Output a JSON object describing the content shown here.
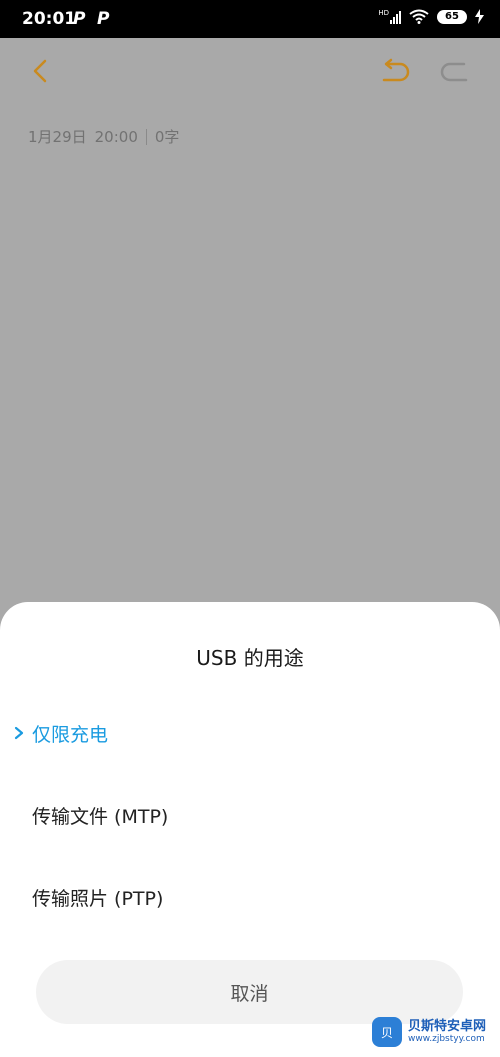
{
  "status_bar": {
    "time": "20:01",
    "notif_glyph_1": "P",
    "notif_glyph_2": "P",
    "hd_label": "HD",
    "battery_level": "65",
    "icons": [
      "signal-icon",
      "wifi-icon",
      "battery-icon",
      "charging-icon"
    ]
  },
  "toolbar": {
    "back_icon": "chevron-left-icon",
    "undo_icon": "undo-icon",
    "redo_icon": "redo-icon",
    "accent_color": "#c98a1f"
  },
  "note": {
    "date": "1月29日",
    "time": "20:00",
    "word_count": "0字"
  },
  "dialog": {
    "title": "USB 的用途",
    "options": [
      {
        "label": "仅限充电",
        "selected": true
      },
      {
        "label": "传输文件 (MTP)",
        "selected": false
      },
      {
        "label": "传输照片 (PTP)",
        "selected": false
      }
    ],
    "cancel_label": "取消",
    "selected_color": "#1a9be0"
  },
  "watermark": {
    "logo_text": "贝",
    "name": "贝斯特安卓网",
    "url": "www.zjbstyy.com"
  }
}
